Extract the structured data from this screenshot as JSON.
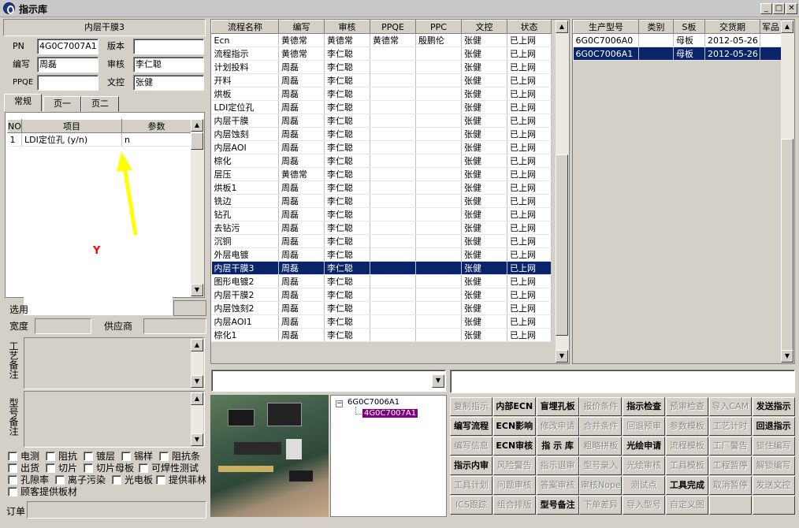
{
  "window": {
    "title": "指示库"
  },
  "left": {
    "header": "内层干膜3",
    "pn_label": "PN",
    "pn_value": "4G0C7007A1",
    "version_label": "版本",
    "version_value": "",
    "writer_label": "编写",
    "writer_value": "周磊",
    "review_label": "审核",
    "review_value": "李仁聪",
    "ppqe_label": "PPQE",
    "ppqe_value": "",
    "doc_label": "文控",
    "doc_value": "张健",
    "tabs": [
      "常规",
      "页一",
      "页二"
    ],
    "param_cols": [
      "NO",
      "项目",
      "参数"
    ],
    "param_rows": [
      {
        "no": "1",
        "item": "LDI定位孔 (y/n)",
        "value": "n"
      }
    ],
    "annotation_letter": "Y",
    "select_label": "选用",
    "width_label": "宽度",
    "width_value": "",
    "supplier_label": "供应商",
    "supplier_value": "",
    "process_note_label": "工艺备注",
    "model_note_label": "型号备注",
    "checkboxes": [
      [
        "电测",
        "阻抗",
        "镀层",
        "锡样",
        "阻抗条"
      ],
      [
        "出货",
        "切片",
        "切片母板",
        "可焊性测试"
      ],
      [
        "孔隙率",
        "离子污染",
        "光电板",
        "提供菲林"
      ],
      [
        "顾客提供板材"
      ]
    ],
    "order_label": "订单"
  },
  "flow": {
    "cols": [
      "流程名称",
      "编写",
      "审核",
      "PPQE",
      "PPC",
      "文控",
      "状态"
    ],
    "rows": [
      [
        "Ecn",
        "黄德常",
        "黄德常",
        "黄德常",
        "殷鹏伦",
        "张健",
        "已上网"
      ],
      [
        "流程指示",
        "黄德常",
        "李仁聪",
        "",
        "",
        "张健",
        "已上网"
      ],
      [
        "计划投料",
        "周磊",
        "李仁聪",
        "",
        "",
        "张健",
        "已上网"
      ],
      [
        "开料",
        "周磊",
        "李仁聪",
        "",
        "",
        "张健",
        "已上网"
      ],
      [
        "烘板",
        "周磊",
        "李仁聪",
        "",
        "",
        "张健",
        "已上网"
      ],
      [
        "LDI定位孔",
        "周磊",
        "李仁聪",
        "",
        "",
        "张健",
        "已上网"
      ],
      [
        "内层干膜",
        "周磊",
        "李仁聪",
        "",
        "",
        "张健",
        "已上网"
      ],
      [
        "内层蚀刻",
        "周磊",
        "李仁聪",
        "",
        "",
        "张健",
        "已上网"
      ],
      [
        "内层AOI",
        "周磊",
        "李仁聪",
        "",
        "",
        "张健",
        "已上网"
      ],
      [
        "棕化",
        "周磊",
        "李仁聪",
        "",
        "",
        "张健",
        "已上网"
      ],
      [
        "层压",
        "黄德常",
        "李仁聪",
        "",
        "",
        "张健",
        "已上网"
      ],
      [
        "烘板1",
        "周磊",
        "李仁聪",
        "",
        "",
        "张健",
        "已上网"
      ],
      [
        "铣边",
        "周磊",
        "李仁聪",
        "",
        "",
        "张健",
        "已上网"
      ],
      [
        "钻孔",
        "周磊",
        "李仁聪",
        "",
        "",
        "张健",
        "已上网"
      ],
      [
        "去钻污",
        "周磊",
        "李仁聪",
        "",
        "",
        "张健",
        "已上网"
      ],
      [
        "沉铜",
        "周磊",
        "李仁聪",
        "",
        "",
        "张健",
        "已上网"
      ],
      [
        "外层电镀",
        "周磊",
        "李仁聪",
        "",
        "",
        "张健",
        "已上网"
      ],
      [
        "内层干膜3",
        "周磊",
        "李仁聪",
        "",
        "",
        "张健",
        "已上网"
      ],
      [
        "图形电镀2",
        "周磊",
        "李仁聪",
        "",
        "",
        "张健",
        "已上网"
      ],
      [
        "内层干膜2",
        "周磊",
        "李仁聪",
        "",
        "",
        "张健",
        "已上网"
      ],
      [
        "内层蚀刻2",
        "周磊",
        "李仁聪",
        "",
        "",
        "张健",
        "已上网"
      ],
      [
        "内层AOI1",
        "周磊",
        "李仁聪",
        "",
        "",
        "张健",
        "已上网"
      ],
      [
        "棕化1",
        "周磊",
        "李仁聪",
        "",
        "",
        "张健",
        "已上网"
      ]
    ],
    "selected_index": 17
  },
  "models": {
    "cols": [
      "生产型号",
      "类别",
      "S板",
      "交货期",
      "军品"
    ],
    "rows": [
      [
        "6G0C7006A0",
        "",
        "母板",
        "2012-05-26",
        ""
      ],
      [
        "6G0C7006A1",
        "",
        "母板",
        "2012-05-26",
        ""
      ]
    ],
    "selected_index": 1
  },
  "tree": {
    "root": "6G0C7006A1",
    "child": "4G0C7007A1"
  },
  "buttons": [
    [
      [
        "复制指示",
        0
      ],
      [
        "内部ECN",
        1
      ],
      [
        "盲埋孔板",
        1
      ],
      [
        "报价条件",
        0
      ],
      [
        "指示检查",
        1
      ],
      [
        "预审检查",
        0
      ],
      [
        "导入CAM",
        0
      ],
      [
        "发送指示",
        1
      ]
    ],
    [
      [
        "编写流程",
        1
      ],
      [
        "ECN影响",
        1
      ],
      [
        "修改申请",
        0
      ],
      [
        "合并条件",
        0
      ],
      [
        "回退预审",
        0
      ],
      [
        "参数模板",
        0
      ],
      [
        "工艺计时",
        0
      ],
      [
        "回退指示",
        1
      ]
    ],
    [
      [
        "编写信息",
        0
      ],
      [
        "ECN审核",
        1
      ],
      [
        "指 示 库",
        1
      ],
      [
        "粗略拼板",
        0
      ],
      [
        "光绘申请",
        1
      ],
      [
        "流程模板",
        0
      ],
      [
        "工厂警告",
        0
      ],
      [
        "锁住编写",
        0
      ]
    ],
    [
      [
        "指示内审",
        1
      ],
      [
        "风险警告",
        0
      ],
      [
        "指示退审",
        0
      ],
      [
        "型号录入",
        0
      ],
      [
        "光绘审核",
        0
      ],
      [
        "工具模板",
        0
      ],
      [
        "工程暂停",
        0
      ],
      [
        "解锁编写",
        0
      ]
    ],
    [
      [
        "工具计划",
        0
      ],
      [
        "问题审核",
        0
      ],
      [
        "答案审核",
        0
      ],
      [
        "审核Nope",
        0
      ],
      [
        "测试点",
        0
      ],
      [
        "工具完成",
        1
      ],
      [
        "取消暂停",
        0
      ],
      [
        "发送文控",
        0
      ]
    ],
    [
      [
        "ICS跟踪",
        0
      ],
      [
        "组合排版",
        0
      ],
      [
        "型号备注",
        1
      ],
      [
        "下单差异",
        0
      ],
      [
        "导入型号",
        0
      ],
      [
        "自定义图",
        0
      ],
      [
        "",
        0
      ],
      [
        "",
        0
      ]
    ]
  ],
  "colors": {
    "selection": "#0a246a",
    "annotation_arrow": "#ffff00",
    "annotation_text": "#ff0000",
    "tree_highlight": "#800080"
  }
}
